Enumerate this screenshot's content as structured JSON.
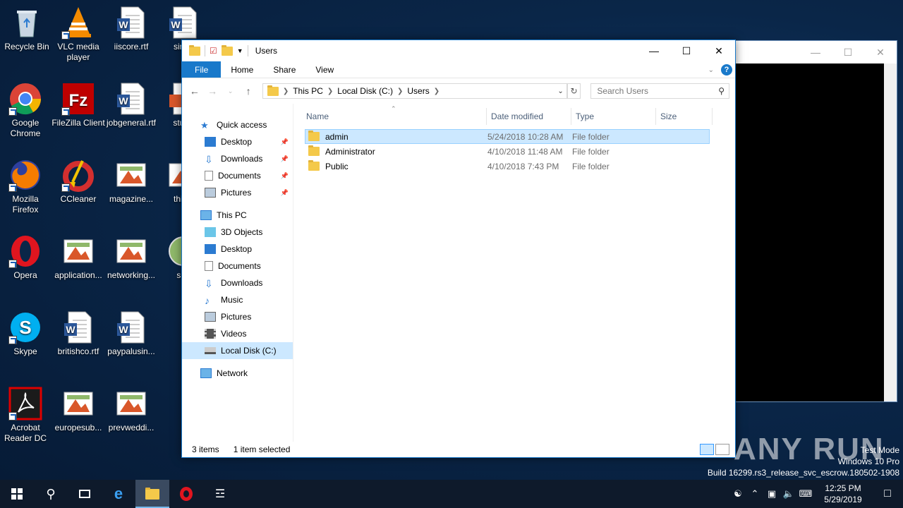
{
  "desktop": {
    "icons": [
      {
        "label": "Recycle Bin"
      },
      {
        "label": "VLC media player"
      },
      {
        "label": "iiscore.rtf"
      },
      {
        "label": "simpl"
      },
      {
        "label": "Google Chrome"
      },
      {
        "label": "FileZilla Client"
      },
      {
        "label": "jobgeneral.rtf"
      },
      {
        "label": "stude"
      },
      {
        "label": "Mozilla Firefox"
      },
      {
        "label": "CCleaner"
      },
      {
        "label": "magazine..."
      },
      {
        "label": "thinki"
      },
      {
        "label": "Opera"
      },
      {
        "label": "application..."
      },
      {
        "label": "networking..."
      },
      {
        "label": "sha"
      },
      {
        "label": "Skype"
      },
      {
        "label": "britishco.rtf"
      },
      {
        "label": "paypalusin..."
      },
      {
        "label": "Acrobat Reader DC"
      },
      {
        "label": "europesub..."
      },
      {
        "label": "prevweddi..."
      }
    ]
  },
  "explorer": {
    "title": "Users",
    "ribbon_tabs": [
      "File",
      "Home",
      "Share",
      "View"
    ],
    "breadcrumb": [
      "This PC",
      "Local Disk (C:)",
      "Users"
    ],
    "search_placeholder": "Search Users",
    "nav": {
      "quick_access": "Quick access",
      "quick_items": [
        "Desktop",
        "Downloads",
        "Documents",
        "Pictures"
      ],
      "this_pc": "This PC",
      "pc_items": [
        "3D Objects",
        "Desktop",
        "Documents",
        "Downloads",
        "Music",
        "Pictures",
        "Videos",
        "Local Disk (C:)"
      ],
      "network": "Network"
    },
    "columns": [
      "Name",
      "Date modified",
      "Type",
      "Size"
    ],
    "files": [
      {
        "name": "admin",
        "date": "5/24/2018 10:28 AM",
        "type": "File folder"
      },
      {
        "name": "Administrator",
        "date": "4/10/2018 11:48 AM",
        "type": "File folder"
      },
      {
        "name": "Public",
        "date": "4/10/2018 7:43 PM",
        "type": "File folder"
      }
    ],
    "status": {
      "count": "3 items",
      "selected": "1 item selected"
    }
  },
  "watermark": {
    "brand": "ANY RUN",
    "line1": "Test Mode",
    "line2": "Windows 10 Pro",
    "line3": "Build 16299.rs3_release_svc_escrow.180502-1908"
  },
  "taskbar": {
    "time": "12:25 PM",
    "date": "5/29/2019"
  }
}
